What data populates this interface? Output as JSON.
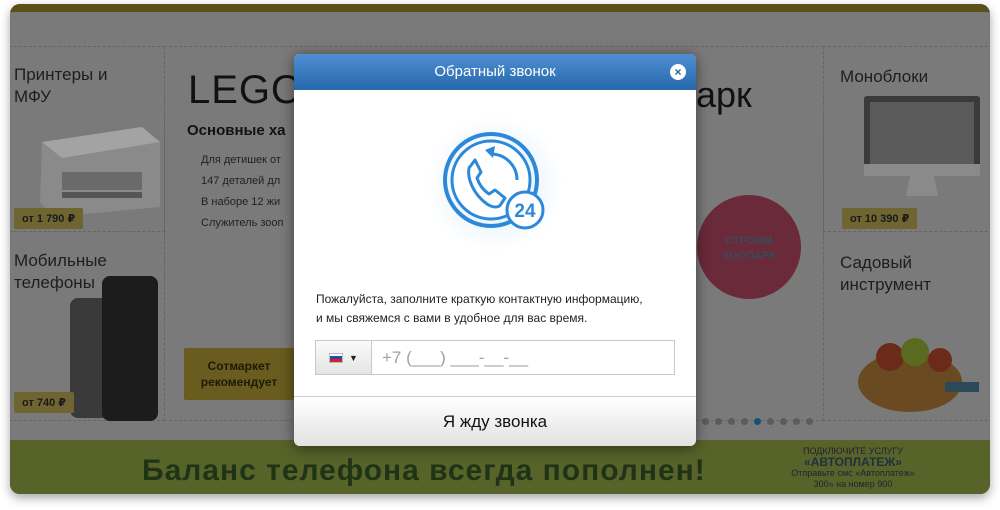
{
  "background": {
    "categories": [
      {
        "title": "Принтеры и МФУ",
        "price": "от 1 790 ₽"
      },
      {
        "title": "Мобильные телефоны",
        "price": "от 740 ₽"
      },
      {
        "title": "Моноблоки",
        "price": "от 10 390 ₽"
      },
      {
        "title": "Садовый инструмент"
      }
    ],
    "promo": {
      "title": "LEGO",
      "subtitle": "Основные ха",
      "bullets": [
        "Для детишек от",
        "147 деталей дл",
        "В наборе 12 жи",
        "Служитель зооп"
      ],
      "recommend_label": "Сотмаркет рекомендует"
    },
    "park_title": "арк",
    "seal_text": "СТРОИМ ЗООПАРК",
    "banner": {
      "text": "Баланс телефона всегда пополнен!",
      "right_line1": "ПОДКЛЮЧИТЕ УСЛУГУ",
      "right_line2": "«АВТОПЛАТЕЖ»",
      "right_line3": "Отправьте смс «Автоплатеж»",
      "right_line4": "300» на номер 900"
    },
    "pager_count": 9,
    "pager_active": 4
  },
  "modal": {
    "title": "Обратный звонок",
    "close_label": "×",
    "icon": "callback-24-icon",
    "badge": "24",
    "description_line1": "Пожалуйста, заполните краткую контактную информацию,",
    "description_line2": "и мы свяжемся с вами в удобное для вас время.",
    "country_flag": "russia-flag-icon",
    "phone_placeholder": "+7 (___) ___-__-__",
    "submit_label": "Я жду звонка"
  },
  "colors": {
    "header_top": "#4f8fd0",
    "header_bottom": "#2667ad",
    "icon_blue": "#2c88d9"
  }
}
